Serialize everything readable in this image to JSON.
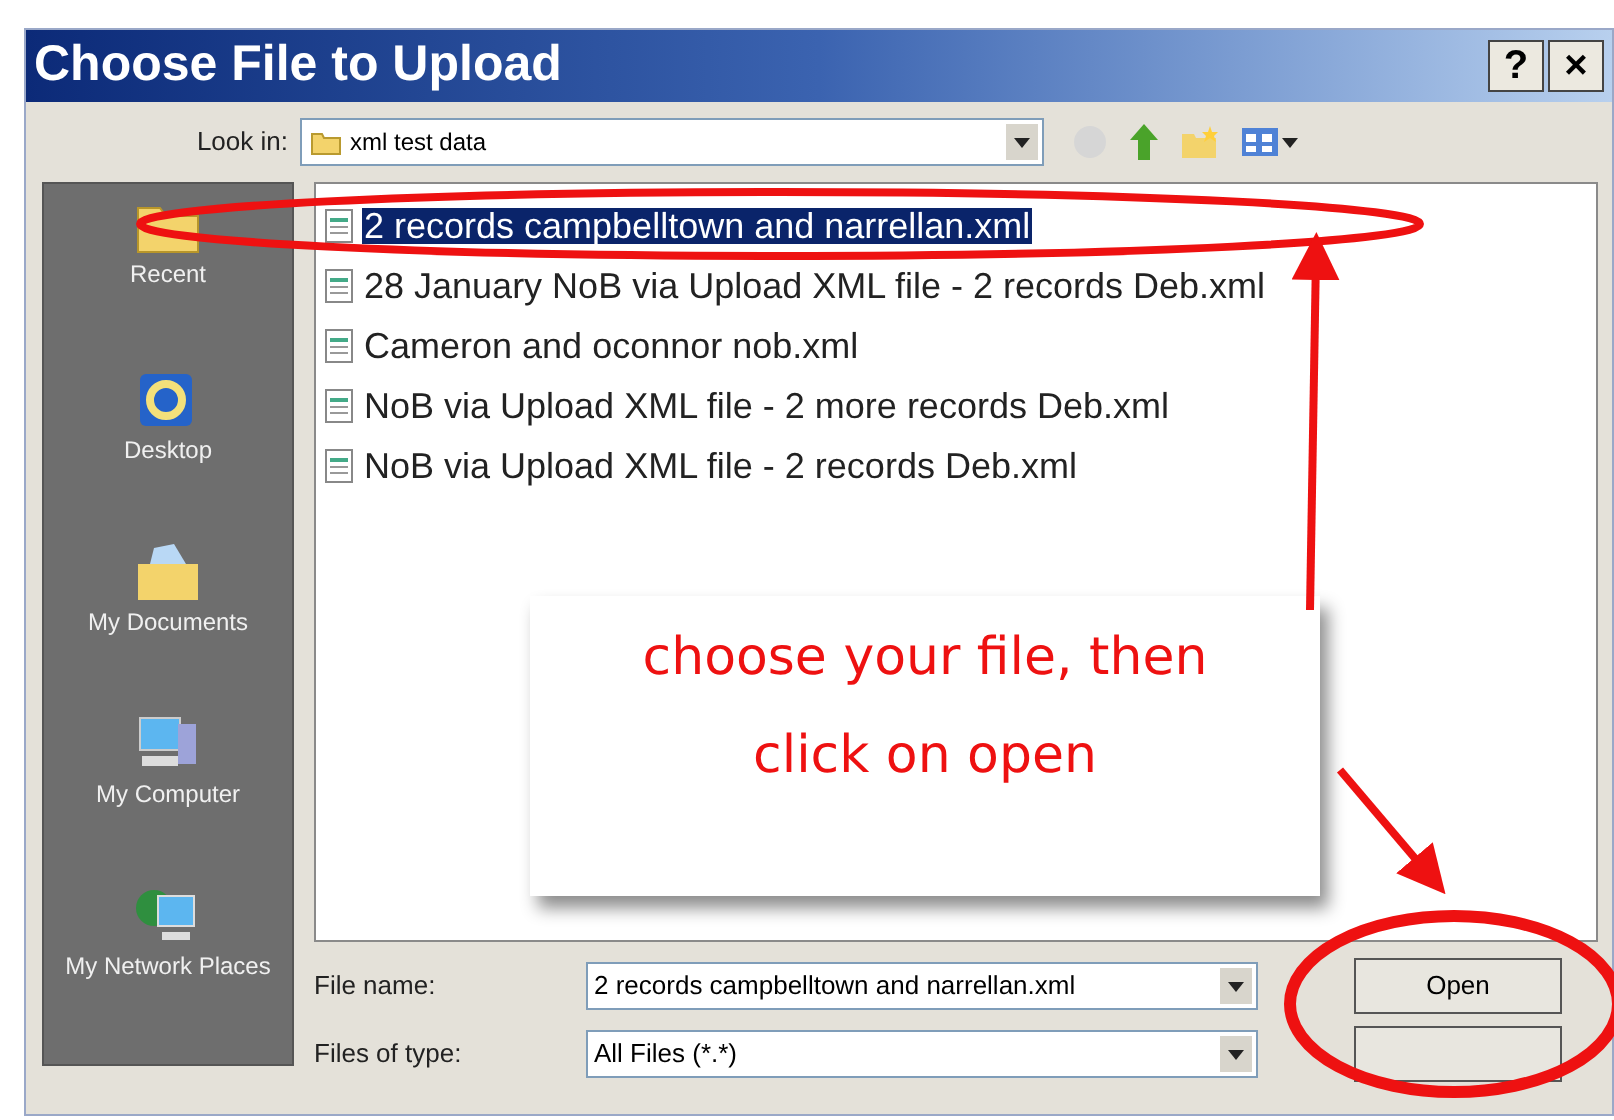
{
  "window": {
    "title": "Choose File to Upload",
    "buttons": [
      "?",
      "×"
    ]
  },
  "look_in": {
    "label": "Look in:",
    "value": "xml test data"
  },
  "places": [
    {
      "label": "Recent",
      "kind": "recent"
    },
    {
      "label": "Desktop",
      "kind": "desktop"
    },
    {
      "label": "My Documents",
      "kind": "documents"
    },
    {
      "label": "My Computer",
      "kind": "computer"
    },
    {
      "label": "My Network Places",
      "kind": "network"
    }
  ],
  "files": [
    {
      "name": "2 records campbelltown and narrellan.xml",
      "selected": true
    },
    {
      "name": "28 January NoB via Upload XML file - 2 records Deb.xml",
      "selected": false
    },
    {
      "name": "Cameron and oconnor nob.xml",
      "selected": false
    },
    {
      "name": "NoB via Upload XML file - 2 more records Deb.xml",
      "selected": false
    },
    {
      "name": "NoB via Upload XML file - 2 records Deb.xml",
      "selected": false
    }
  ],
  "file_name": {
    "label": "File name:",
    "value": "2 records campbelltown and narrellan.xml"
  },
  "file_type": {
    "label": "Files of type:",
    "value": "All Files (*.*)"
  },
  "open_button": "Open",
  "annotation": {
    "lines": [
      "choose your file, then",
      "click on open"
    ]
  }
}
